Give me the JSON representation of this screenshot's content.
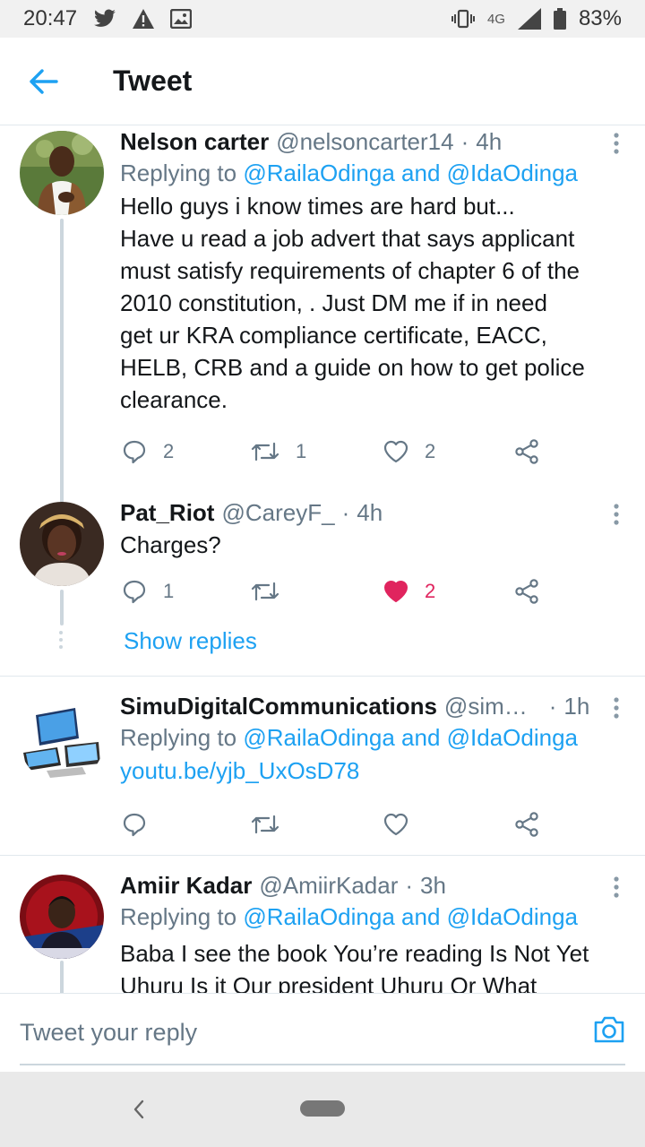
{
  "status_bar": {
    "time": "20:47",
    "network": "4G",
    "battery": "83%",
    "icons": [
      "twitter-icon",
      "warning-icon",
      "image-icon",
      "vibrate-icon",
      "signal-icon",
      "battery-icon"
    ]
  },
  "header": {
    "title": "Tweet",
    "back_icon": "arrow-left-icon"
  },
  "tweets": [
    {
      "name": "Nelson carter",
      "handle": "@nelsoncarter14",
      "time": "4h",
      "replying_prefix": "Replying to ",
      "replying_to": "@RailaOdinga and @IdaOdinga",
      "text": "Hello guys i know times are hard but...\nHave u read a job advert that says applicant\nmust satisfy requirements of chapter 6 of the\n2010 constitution,  .  Just DM me if in need\nget ur KRA compliance certificate,  EACC,\nHELB, CRB and a guide on how to get police\nclearance.",
      "replies": "2",
      "retweets": "1",
      "likes": "2"
    },
    {
      "name": "Pat_Riot",
      "handle": "@CareyF_",
      "time": "4h",
      "text": "Charges?",
      "replies": "1",
      "retweets": "",
      "likes": "2",
      "liked": true
    },
    {
      "name": "SimuDigitalCommunications",
      "handle": "@sim…",
      "time": "1h",
      "replying_prefix": "Replying to ",
      "replying_to": "@RailaOdinga and @IdaOdinga",
      "link": "youtu.be/yjb_UxOsD78",
      "replies": "",
      "retweets": "",
      "likes": ""
    },
    {
      "name": "Amiir Kadar",
      "handle": "@AmiirKadar",
      "time": "3h",
      "replying_prefix": "Replying to ",
      "replying_to": "@RailaOdinga and @IdaOdinga",
      "text": "Baba I see the book You’re reading Is Not Yet\nUhuru  Is it Our president Uhuru Or What"
    }
  ],
  "show_replies": "Show replies",
  "composer": {
    "placeholder": "Tweet your reply",
    "camera_icon": "camera-icon"
  },
  "colors": {
    "accent": "#1da1f2",
    "like": "#e0245e",
    "muted": "#657786"
  }
}
